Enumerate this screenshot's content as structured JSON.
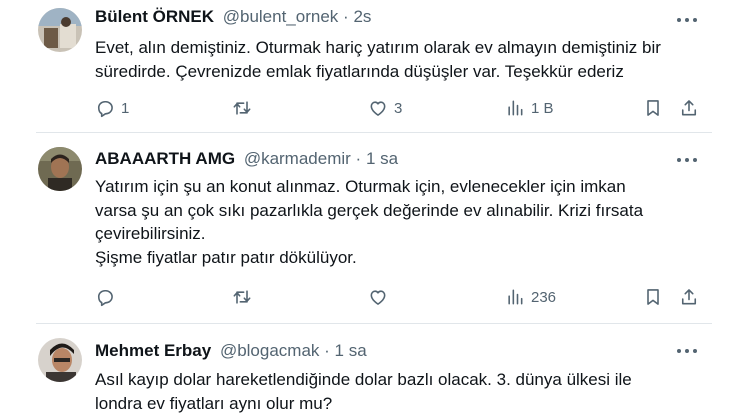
{
  "tweets": [
    {
      "name": "Bülent ÖRNEK",
      "handle": "@bulent_ornek",
      "time": "2s",
      "avatar_icon": "avatar-photo",
      "lines": [
        "Evet, alın demiştiniz. Oturmak hariç yatırım olarak ev almayın demiştiniz bir",
        "süredirde. Çevrenizde emlak fiyatlarında düşüşler var. Teşekkür ederiz"
      ],
      "replies": "1",
      "retweets": "",
      "likes": "3",
      "views": "1 B"
    },
    {
      "name": "ABAAARTH AMG",
      "handle": "@karmademir",
      "time": "1 sa",
      "avatar_icon": "avatar-photo",
      "lines": [
        "Yatırım için şu an konut alınmaz. Oturmak için, evlenecekler için imkan",
        "varsa şu an çok sıkı pazarlıkla gerçek değerinde ev alınabilir. Krizi fırsata",
        "çevirebilirsiniz.",
        "Şişme fiyatlar patır patır dökülüyor."
      ],
      "replies": "",
      "retweets": "",
      "likes": "",
      "views": "236"
    },
    {
      "name": "Mehmet Erbay",
      "handle": "@blogacmak",
      "time": "1 sa",
      "avatar_icon": "avatar-photo",
      "lines": [
        "Asıl kayıp dolar hareketlendiğinde dolar bazlı olacak. 3. dünya ülkesi ile",
        "londra ev fiyatları aynı olur mu?"
      ]
    }
  ],
  "separator": "·",
  "colors": {
    "text": "#0f1419",
    "muted": "#536471",
    "divider": "#e1e6ea"
  },
  "icons": [
    "reply-icon",
    "retweet-icon",
    "like-icon",
    "views-icon",
    "bookmark-icon",
    "share-icon",
    "more-icon"
  ]
}
